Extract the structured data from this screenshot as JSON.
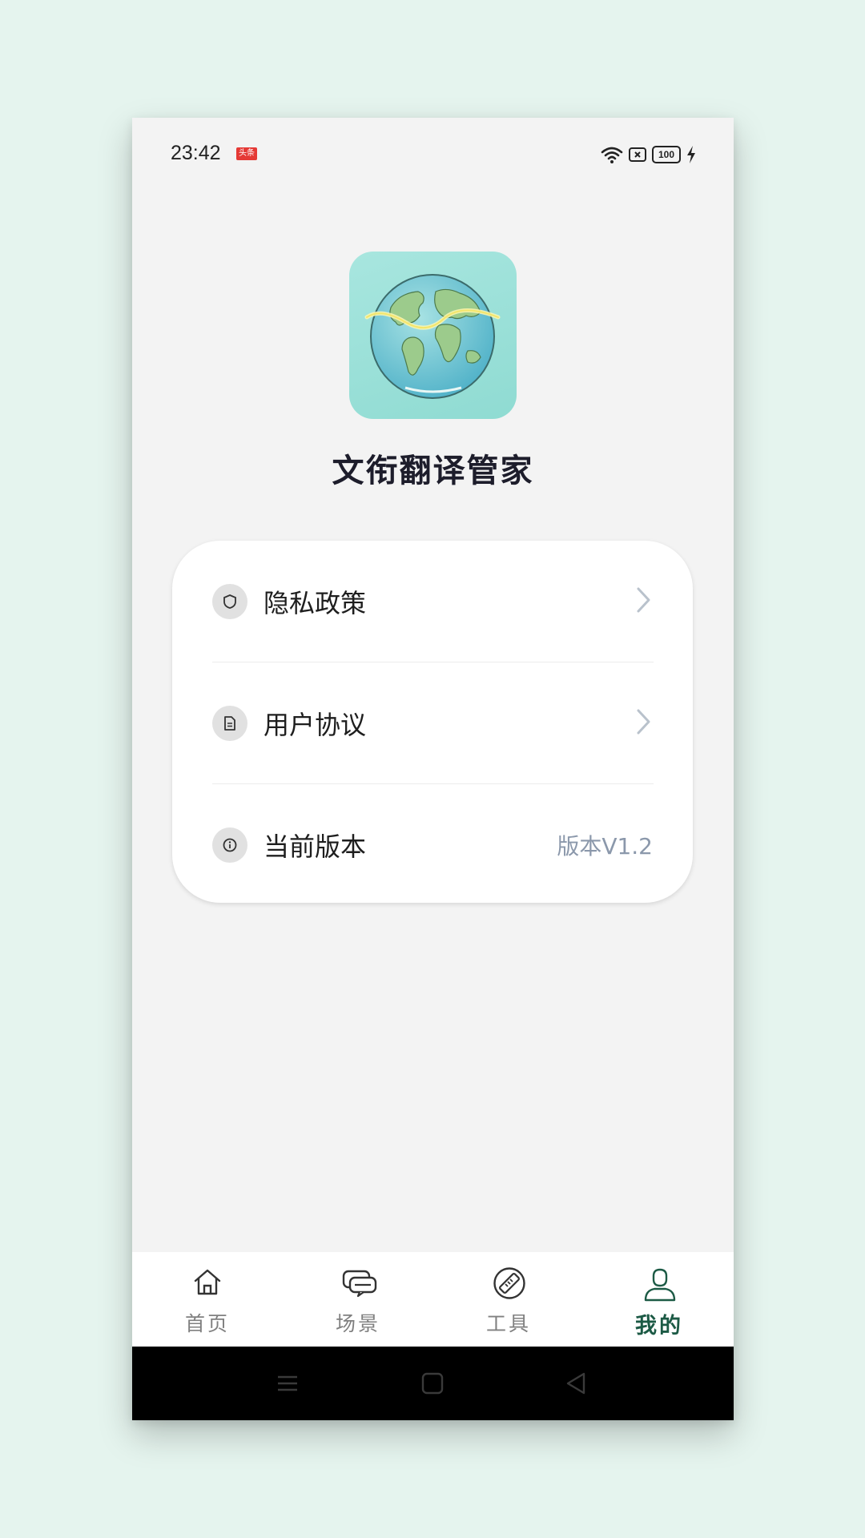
{
  "status_bar": {
    "time": "23:42",
    "news_badge": "头条",
    "battery": "100",
    "icons": [
      "wifi-icon",
      "sim-x-icon",
      "battery-icon",
      "charging-icon"
    ]
  },
  "app": {
    "name": "文衔翻译管家",
    "logo_icon": "globe-icon"
  },
  "settings": {
    "items": [
      {
        "label": "隐私政策",
        "icon": "shield-icon",
        "has_chevron": true
      },
      {
        "label": "用户协议",
        "icon": "document-icon",
        "has_chevron": true
      },
      {
        "label": "当前版本",
        "icon": "info-icon",
        "value": "版本V1.2"
      }
    ]
  },
  "bottom_nav": {
    "items": [
      {
        "label": "首页",
        "icon": "home-icon",
        "active": false
      },
      {
        "label": "场景",
        "icon": "chat-bubbles-icon",
        "active": false
      },
      {
        "label": "工具",
        "icon": "ruler-icon",
        "active": false
      },
      {
        "label": "我的",
        "icon": "profile-icon",
        "active": true
      }
    ]
  },
  "system_nav": {
    "buttons": [
      "menu-icon",
      "home-square-icon",
      "back-triangle-icon"
    ]
  },
  "colors": {
    "background": "#e5f4ee",
    "screen": "#f3f3f3",
    "accent_active": "#1c5a45",
    "version_text": "#8b98ab"
  }
}
